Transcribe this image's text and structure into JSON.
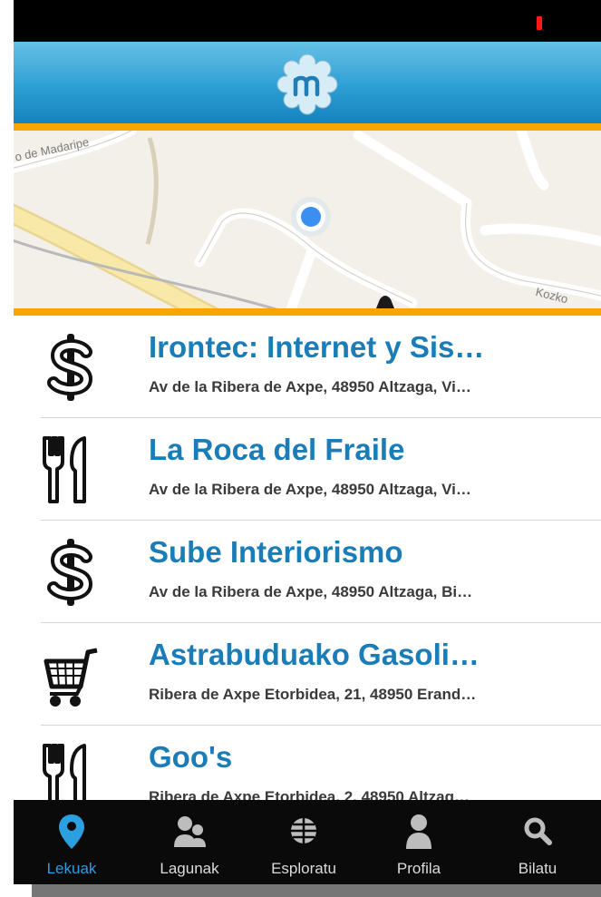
{
  "map": {
    "labels": [
      "o de Madaripe",
      "Kozko"
    ]
  },
  "places": [
    {
      "icon": "dollar-icon",
      "name": "Irontec: Internet y Sis…",
      "address": "Av de la Ribera de Axpe, 48950 Altzaga, Vi…"
    },
    {
      "icon": "fork-knife-icon",
      "name": "La Roca del Fraile",
      "address": "Av de la Ribera de Axpe, 48950 Altzaga, Vi…"
    },
    {
      "icon": "dollar-icon",
      "name": "Sube Interiorismo",
      "address": "Av de la Ribera de Axpe, 48950 Altzaga, Bi…"
    },
    {
      "icon": "shopping-cart-icon",
      "name": "Astrabuduako Gasoli…",
      "address": "Ribera de Axpe Etorbidea, 21, 48950 Erand…"
    },
    {
      "icon": "fork-knife-icon",
      "name": "Goo's",
      "address": "Ribera de Axpe Etorbidea, 2, 48950 Altzag…"
    }
  ],
  "tabs": [
    {
      "label": "Lekuak",
      "icon": "location-pin-icon",
      "active": true
    },
    {
      "label": "Lagunak",
      "icon": "friends-icon",
      "active": false
    },
    {
      "label": "Esploratu",
      "icon": "globe-icon",
      "active": false
    },
    {
      "label": "Profila",
      "icon": "person-icon",
      "active": false
    },
    {
      "label": "Bilatu",
      "icon": "search-icon",
      "active": false
    }
  ],
  "colors": {
    "accent": "#f7a600",
    "brand": "#1b7db8",
    "active_tab": "#2b9fe0"
  }
}
